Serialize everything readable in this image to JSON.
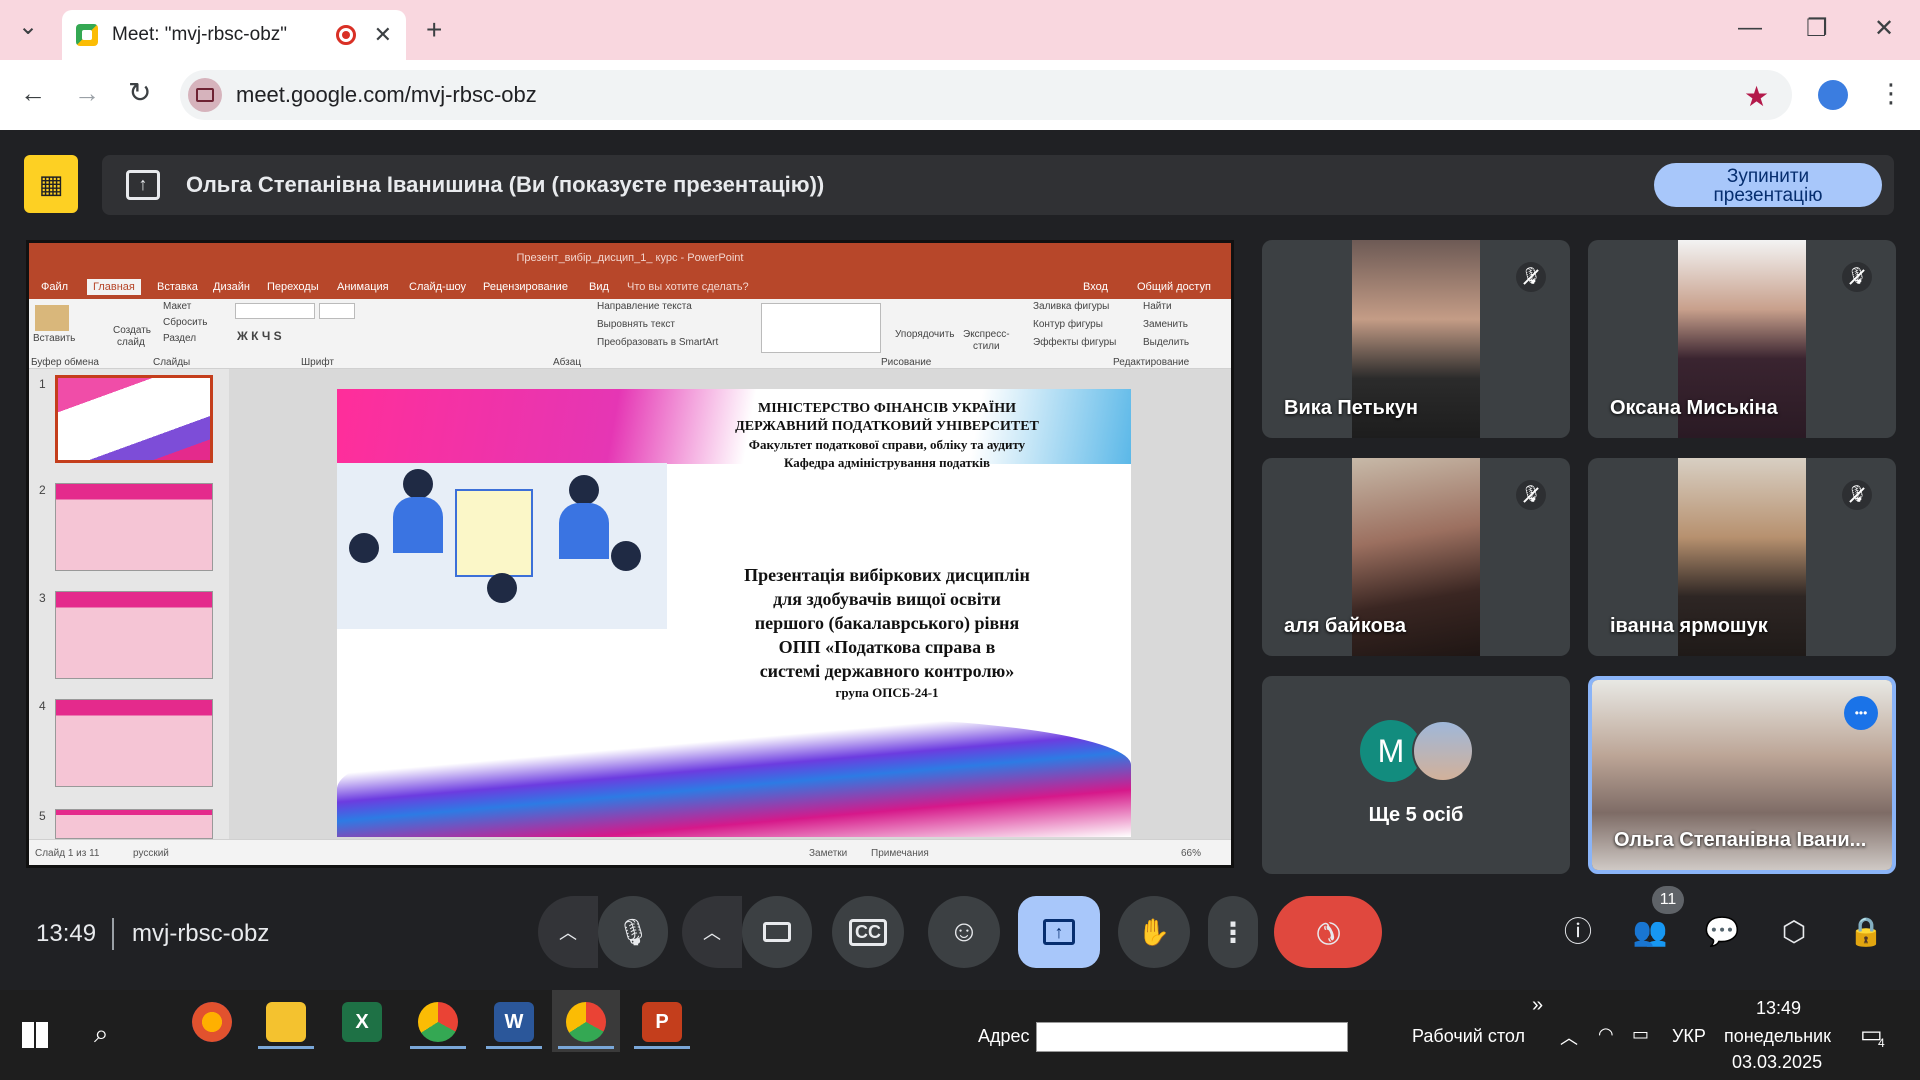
{
  "browser": {
    "tab_title": "Meet: \"mvj-rbsc-obz\"",
    "tab_close": "✕",
    "new_tab": "+",
    "tab_list": "⌄",
    "win_min": "—",
    "win_restore": "❐",
    "win_close": "✕",
    "back": "←",
    "forward": "→",
    "reload": "↻",
    "url": "meet.google.com/mvj-rbsc-obz",
    "bookmark": "★",
    "menu": "⋮"
  },
  "presentation_bar": {
    "title": "Ольга Степанівна Іванишина (Ви (показуєте презентацію))",
    "stop_button_line1": "Зупинити",
    "stop_button_line2": "презентацію"
  },
  "powerpoint": {
    "window_title": "Презент_вибір_дисцип_1_ курс - PowerPoint",
    "tabs": [
      "Файл",
      "Главная",
      "Вставка",
      "Дизайн",
      "Переходы",
      "Анимация",
      "Слайд-шоу",
      "Рецензирование",
      "Вид",
      "Что вы хотите сделать?"
    ],
    "login": "Вход",
    "share": "Общий доступ",
    "ribbon": {
      "paste": "Вставить",
      "clipboard": "Буфер обмена",
      "layout": "Макет",
      "reset": "Сбросить",
      "new_slide_1": "Создать",
      "new_slide_2": "слайд",
      "section": "Раздел",
      "slides": "Слайды",
      "font_group": "Шрифт",
      "paragraph": "Абзац",
      "text_direction": "Направление текста",
      "align_text": "Выровнять текст",
      "smartart": "Преобразовать в SmartArt",
      "arrange": "Упорядочить",
      "quick_styles_1": "Экспресс-",
      "quick_styles_2": "стили",
      "shape_fill": "Заливка фигуры",
      "shape_outline": "Контур фигуры",
      "shape_effects": "Эффекты фигуры",
      "drawing": "Рисование",
      "find": "Найти",
      "replace": "Заменить",
      "select": "Выделить",
      "editing": "Редактирование",
      "font_style_buttons": "Ж К Ч S"
    },
    "thumb_numbers": [
      "1",
      "2",
      "3",
      "4",
      "5"
    ],
    "slide": {
      "line1": "МІНІСТЕРСТВО ФІНАНСІВ УКРАЇНИ",
      "line2": "ДЕРЖАВНИЙ ПОДАТКОВИЙ УНІВЕРСИТЕТ",
      "line3": "Факультет податкової справи, обліку та аудиту",
      "line4": "Кафедра адміністрування податків",
      "main1": "Презентація вибіркових дисциплін",
      "main2": "для здобувачів вищої освіти",
      "main3": "першого (бакалаврського) рівня",
      "main4": "ОПП «Податкова справа в",
      "main5": "системі державного контролю»",
      "group": "група ОПСБ-24-1"
    },
    "status": {
      "slide_of": "Слайд 1 из 11",
      "language": "русский",
      "notes": "Заметки",
      "comments": "Примечания",
      "zoom": "66%"
    }
  },
  "participants": [
    {
      "name": "Вика Петькун",
      "muted": true
    },
    {
      "name": "Оксана Миськіна",
      "muted": true
    },
    {
      "name": "аля байкова",
      "muted": true
    },
    {
      "name": "іванна ярмошук",
      "muted": true
    },
    {
      "name": "Ще 5 осіб",
      "avatar_letter": "M"
    },
    {
      "name": "Ольга Степанівна Івани...",
      "more": "•••"
    }
  ],
  "bottom_bar": {
    "time": "13:49",
    "meeting_code": "mvj-rbsc-obz",
    "people_count": "11"
  },
  "colors": {
    "end_call": "#e0483e",
    "present_active": "#a8c7fa",
    "no_present_badge": "#fdd023",
    "ppt_red": "#b7472a"
  },
  "taskbar": {
    "address_label": "Адрес",
    "desktop": "Рабочий стол",
    "language": "УКР",
    "time": "13:49",
    "day": "понедельник",
    "date": "03.03.2025",
    "notifications": "4",
    "chevrons": "»",
    "excel_letter": "X",
    "word_letter": "W",
    "ppt_letter": "P"
  }
}
